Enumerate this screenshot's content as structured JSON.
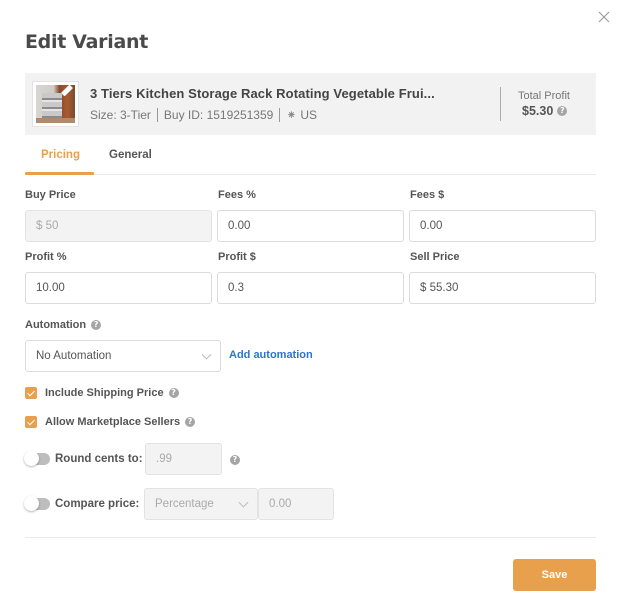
{
  "dialog": {
    "title": "Edit Variant",
    "close_icon": "close-icon"
  },
  "product": {
    "name": "3 Tiers Kitchen Storage Rack Rotating Vegetable Frui...",
    "size": "Size: 3-Tier",
    "buy_id": "Buy ID: 1519251359",
    "marketplace_icon": "walmart-spark-icon",
    "marketplace_glyph": "⁕",
    "region": "US",
    "total_profit_label": "Total Profit",
    "total_profit_value": "$5.30",
    "help_glyph": "?"
  },
  "tabs": [
    {
      "label": "Pricing",
      "active": true
    },
    {
      "label": "General",
      "active": false
    }
  ],
  "pricing": {
    "buy_price": {
      "label": "Buy Price",
      "value": "$ 50",
      "disabled": true
    },
    "fees_pct": {
      "label": "Fees %",
      "value": "0.00"
    },
    "fees_usd": {
      "label": "Fees $",
      "value": "0.00"
    },
    "profit_pct": {
      "label": "Profit %",
      "value": "10.00"
    },
    "profit_usd": {
      "label": "Profit $",
      "value": "0.3"
    },
    "sell_price": {
      "label": "Sell Price",
      "value": "$ 55.30"
    }
  },
  "automation": {
    "label": "Automation",
    "selected": "No Automation",
    "add_link": "Add automation"
  },
  "options": {
    "include_shipping": {
      "label": "Include Shipping Price",
      "checked": true
    },
    "allow_marketplace": {
      "label": "Allow Marketplace Sellers",
      "checked": true
    },
    "round_cents": {
      "label": "Round cents to:",
      "enabled": false,
      "value": ".99"
    },
    "compare_price": {
      "label": "Compare price:",
      "enabled": false,
      "mode": "Percentage",
      "value": "0.00"
    }
  },
  "footer": {
    "save_label": "Save"
  },
  "colors": {
    "accent": "#e8a04c",
    "link": "#2a74d4"
  }
}
